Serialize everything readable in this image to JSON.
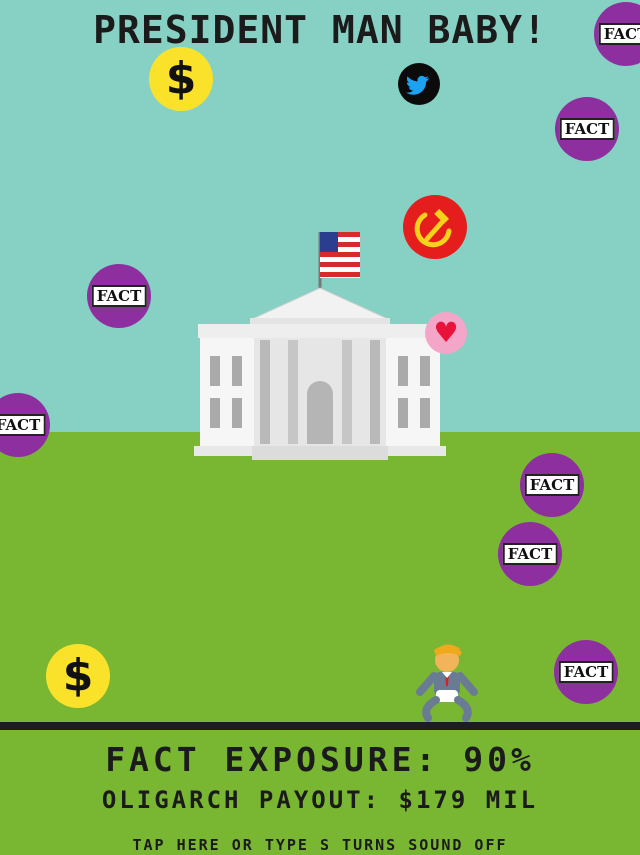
{
  "game": {
    "title": "PRESIDENT MAN BABY!",
    "fact_label": "FACT",
    "dollar_symbol": "$",
    "heart_symbol": "♥"
  },
  "hud": {
    "fact_exposure": "FACT EXPOSURE: 90%",
    "oligarch_payout": "OLIGARCH PAYOUT: $179 MIL",
    "sound_toggle": "TAP HERE OR TYPE S TURNS SOUND OFF"
  },
  "icons": [
    "fact-token",
    "dollar-token",
    "twitter-icon",
    "hammer-sickle-icon",
    "heart-icon",
    "white-house",
    "american-flag",
    "baby-president-player"
  ],
  "colors": {
    "sky": "#86d0c4",
    "grass": "#79b732",
    "fact_token": "#8e2f9f",
    "dollar_token": "#fbe22a",
    "soviet_token": "#e51d1d",
    "heart_token": "#f4a6c8"
  }
}
